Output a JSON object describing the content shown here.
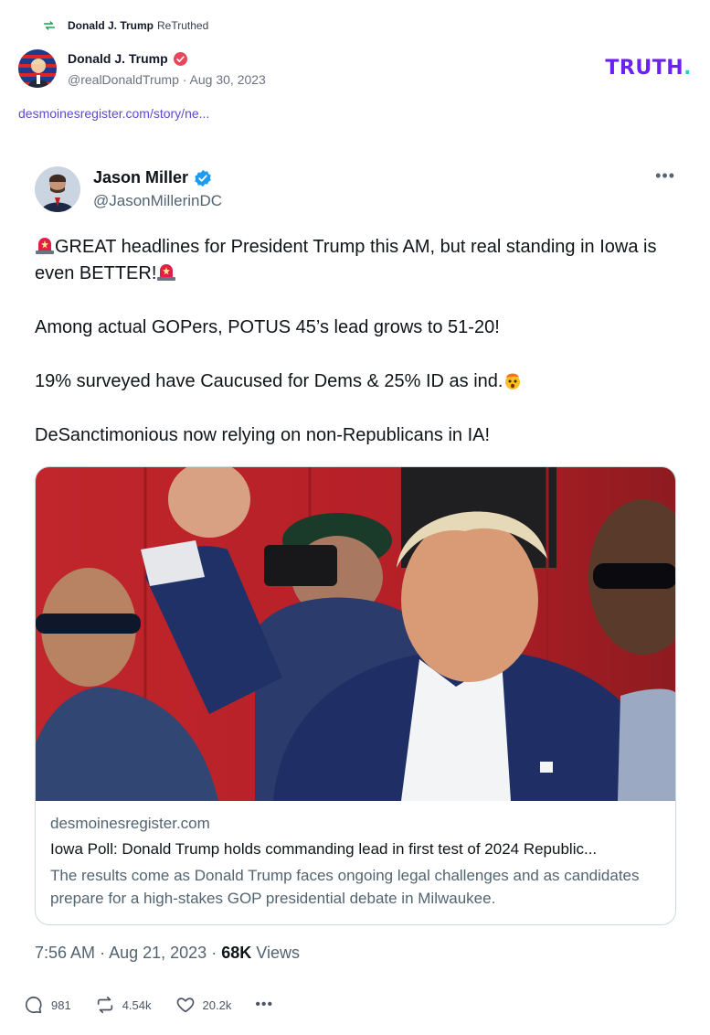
{
  "retruth": {
    "icon": "retruth-icon",
    "user": "Donald J. Trump",
    "label": "ReTruthed"
  },
  "post": {
    "author": "Donald J. Trump",
    "handle": "@realDonaldTrump",
    "separator": "·",
    "date": "Aug 30, 2023",
    "logo_text": "TRUTH",
    "logo_dot": ".",
    "link": "desmoinesregister.com/story/ne...",
    "brand_color": "#6b21f0",
    "accent_color": "#22d3c5",
    "link_color": "#5b4bd1"
  },
  "tweet": {
    "name": "Jason Miller",
    "handle": "@JasonMillerinDC",
    "more": "•••",
    "line1_text": "GREAT headlines for President Trump this AM, but real standing in Iowa is even BETTER!",
    "line2": "Among actual GOPers, POTUS 45’s lead grows to 51-20!",
    "line3": "19% surveyed have Caucused for Dems & 25% ID as ind.",
    "line4": "DeSanctimonious now relying on non-Republicans in IA!",
    "emoji": [
      "siren-emoji",
      "exploding-head-emoji"
    ],
    "card": {
      "domain": "desmoinesregister.com",
      "title": "Iowa Poll: Donald Trump holds commanding lead in first test of 2024 Republic...",
      "description": "The results come as Donald Trump faces ongoing legal challenges and as candidates prepare for a high-stakes GOP presidential debate in Milwaukee."
    },
    "time": "7:56 AM",
    "date": "Aug 21, 2023",
    "sep": "·",
    "views_count": "68K",
    "views_label": "Views"
  },
  "actions": {
    "replies": "981",
    "retruths": "4.54k",
    "likes": "20.2k",
    "more": "•••"
  }
}
